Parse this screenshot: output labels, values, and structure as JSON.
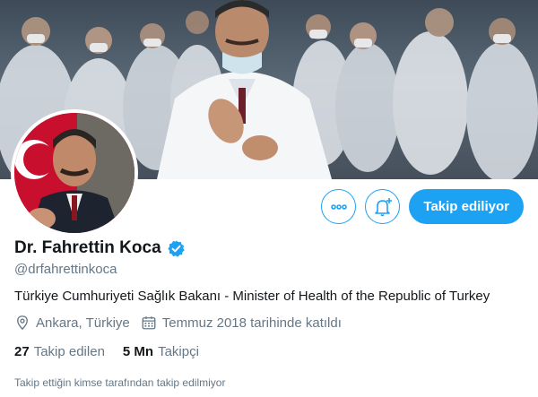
{
  "profile": {
    "name": "Dr. Fahrettin Koca",
    "handle": "@drfahrettinkoca",
    "bio": "Türkiye Cumhuriyeti Sağlık Bakanı - Minister of Health of the Republic of Turkey",
    "location": "Ankara, Türkiye",
    "joined": "Temmuz 2018 tarihinde katıldı",
    "following_count": "27",
    "following_label": "Takip edilen",
    "followers_count": "5 Mn",
    "followers_label": "Takipçi",
    "followed_by_note": "Takip ettiğin kimse tarafından takip edilmiyor",
    "verified": true
  },
  "actions": {
    "more_icon": "more-horizontal-icon",
    "notify_icon": "bell-plus-icon",
    "follow_label": "Takip ediliyor"
  },
  "colors": {
    "accent": "#1da1f2",
    "text": "#14171a",
    "muted": "#657786"
  }
}
